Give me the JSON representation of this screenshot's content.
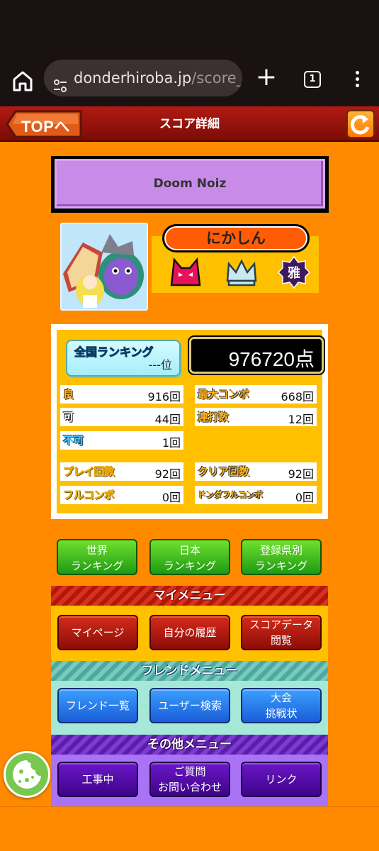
{
  "browser": {
    "url_domain": "donderhiroba.jp",
    "url_path": "/score_c",
    "tab_count": "1"
  },
  "header": {
    "top_button": "TOPへ",
    "title": "スコア詳細"
  },
  "song": {
    "title": "Doom Noiz"
  },
  "player": {
    "name": "にかしん",
    "badges": [
      "oni-icon",
      "crown-icon",
      "dan-miyabi-icon"
    ],
    "badge_text": "雅"
  },
  "score": {
    "rank_label": "全国ランキング",
    "rank_value": "---位",
    "points": "976720点",
    "stats_left": [
      {
        "label": "良",
        "value": "916回"
      },
      {
        "label": "可",
        "value": "44回"
      },
      {
        "label": "不可",
        "value": "1回"
      },
      {
        "label": "プレイ回数",
        "value": "92回"
      },
      {
        "label": "フルコンボ",
        "value": "0回"
      }
    ],
    "stats_right": [
      {
        "label": "最大コンボ",
        "value": "668回"
      },
      {
        "label": "連打数",
        "value": "12回"
      },
      {
        "label": "クリア回数",
        "value": "92回"
      },
      {
        "label": "ドンダフルコンボ",
        "value": "0回"
      }
    ]
  },
  "rankings": {
    "world": "世界\nランキング",
    "japan": "日本\nランキング",
    "prefecture": "登録県別\nランキング"
  },
  "my_menu": {
    "title": "マイメニュー",
    "items": [
      "マイページ",
      "自分の履歴",
      "スコアデータ\n閲覧"
    ]
  },
  "friend_menu": {
    "title": "フレンドメニュー",
    "items": [
      "フレンド一覧",
      "ユーザー検索",
      "大会\n挑戦状"
    ]
  },
  "other_menu": {
    "title": "その他メニュー",
    "items": [
      "工事中",
      "ご質問\nお問い合わせ",
      "リンク"
    ]
  },
  "colors": {
    "page_bg": "#ff8a00",
    "header_red": "#b31a12",
    "panel_yellow": "#ffc000",
    "my_menu_bg": "#ffc000",
    "friend_menu_bg": "#a6e8d8",
    "other_menu_bg": "#a874f5"
  }
}
